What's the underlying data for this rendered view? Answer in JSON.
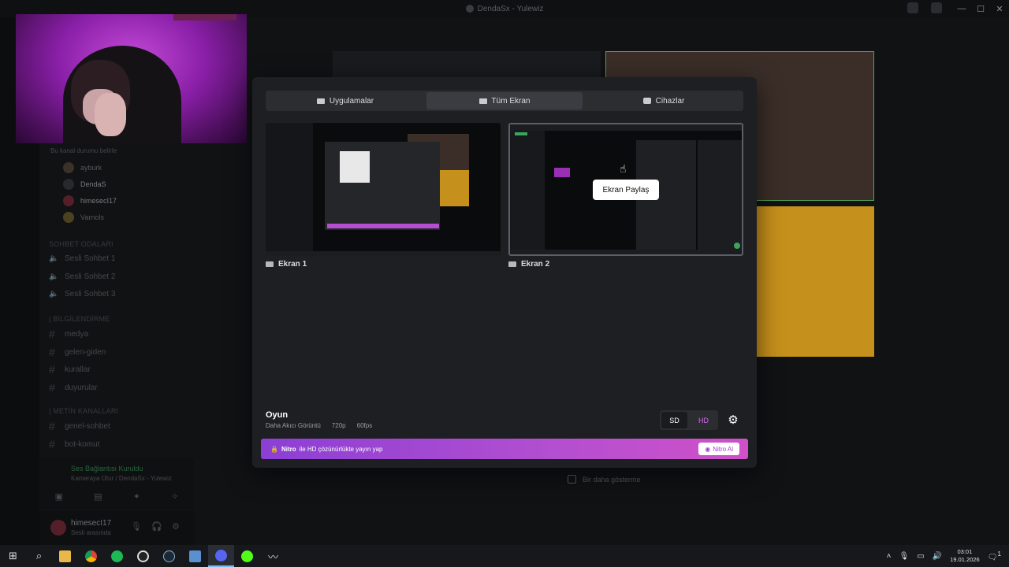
{
  "window": {
    "title": "DendaSx - Yulewiz"
  },
  "sidebar": {
    "status_line": "Bu kanal durumu belirle",
    "voice_users": [
      "ayburk",
      "DendaS",
      "himesecI17",
      "Varnols"
    ],
    "categories": {
      "voice": "SOHBET ODALARI",
      "info": "| BİLGİLENDİRME",
      "text": "| METİN KANALLARI"
    },
    "voice_channels": [
      "Sesli Sohbet 1",
      "Sesli Sohbet 2",
      "Sesli Sohbet 3"
    ],
    "info_channels": [
      "medya",
      "gelen-giden",
      "kurallar",
      "duyurular"
    ],
    "text_channels": [
      "genel-sohbet",
      "bot-komut"
    ],
    "voice_status": "Ses Bağlantısı Kuruldu",
    "voice_sub": "Kameraya Otur / DendaSx - Yulewiz",
    "user": {
      "name": "himesecI17",
      "status": "Sesli arasında"
    }
  },
  "modal": {
    "tabs": [
      {
        "label": "Uygulamalar",
        "icon": "window-icon"
      },
      {
        "label": "Tüm Ekran",
        "icon": "monitor-icon"
      },
      {
        "label": "Cihazlar",
        "icon": "camera-icon"
      }
    ],
    "active_tab": "Tüm Ekran",
    "screens": [
      {
        "label": "Ekran 1"
      },
      {
        "label": "Ekran 2"
      }
    ],
    "tooltip": "Ekran Paylaş",
    "quality": {
      "title": "Oyun",
      "mode": "Daha Akıcı Görüntü",
      "resolution": "720p",
      "fps": "60fps",
      "sd_label": "SD",
      "hd_label": "HD"
    },
    "nitro": {
      "brand": "Nitro",
      "text": "ile HD çözünürlükte yayın yap",
      "button": "Nitro Al"
    }
  },
  "footer": {
    "dont_show": "Bir daha gösterme"
  },
  "taskbar": {
    "time": "03:01",
    "date": "19.01.2026",
    "notification_count": "1"
  },
  "colors": {
    "modal_bg": "#1e1f22",
    "nitro_gradient_start": "#8c3fd4",
    "nitro_gradient_end": "#d050c8",
    "hd_accent": "#d46af0",
    "voice_connected": "#3ba55d"
  }
}
